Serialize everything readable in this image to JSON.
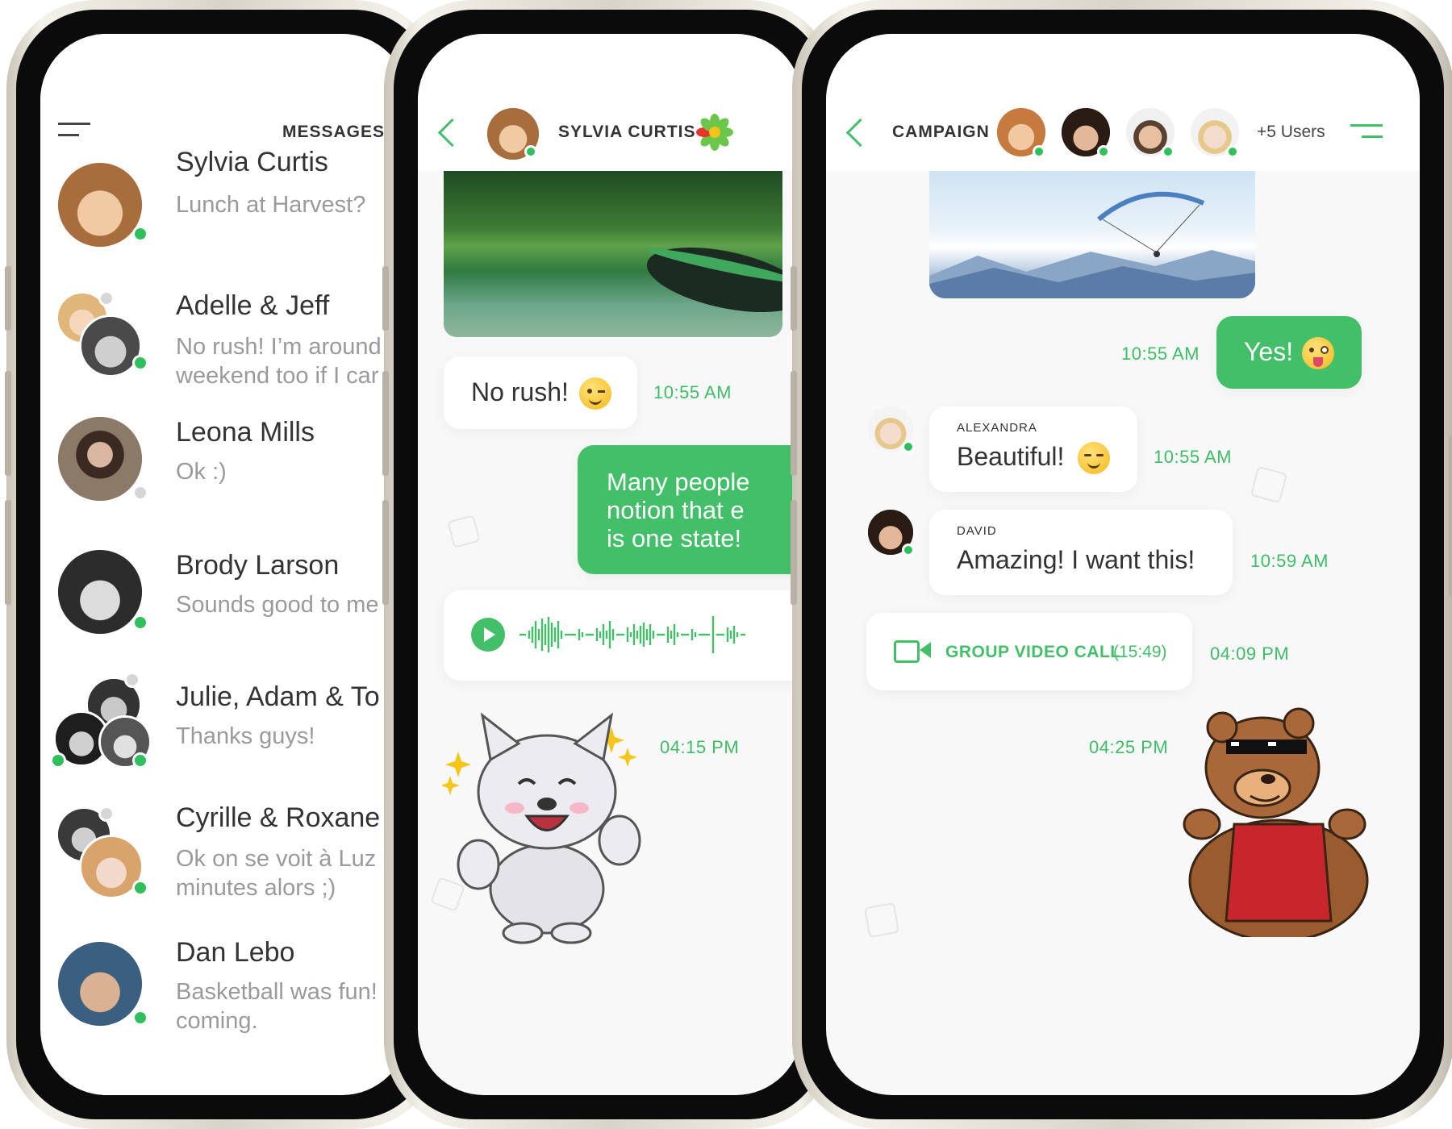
{
  "colors": {
    "accent": "#42bf68",
    "online": "#2fbf5c",
    "offline": "#d6d6d6"
  },
  "inbox": {
    "menu_icon": "hamburger-menu-icon",
    "title": "MESSAGES",
    "conversations": [
      {
        "name": "Sylvia Curtis",
        "preview": "Lunch at Harvest?",
        "status": "online"
      },
      {
        "name": "Adelle & Jeff",
        "preview": "No rush! I’m around\nweekend too if I car",
        "status": "online"
      },
      {
        "name": "Leona Mills",
        "preview": "Ok :)",
        "status": "offline"
      },
      {
        "name": "Brody Larson",
        "preview": "Sounds good to me",
        "status": "online"
      },
      {
        "name": "Julie, Adam & To",
        "preview": "Thanks guys!",
        "status": "online"
      },
      {
        "name": "Cyrille & Roxane",
        "preview": "Ok on se voit à Luz\nminutes alors ;)",
        "status": "online"
      },
      {
        "name": "Dan Lebo",
        "preview": "Basketball was fun!\ncoming.",
        "status": "online"
      }
    ]
  },
  "chat": {
    "back_icon": "chevron-left-icon",
    "contact_name": "SYLVIA CURTIS",
    "logo_icon": "flower-logo-icon",
    "messages": {
      "m1_text": "No rush!",
      "m1_time": "10:55 AM",
      "m2_text": "Many people\nnotion that e\nis one state!",
      "voice_icon": "play-icon",
      "sticker_time": "04:15 PM"
    }
  },
  "group": {
    "back_icon": "chevron-left-icon",
    "title": "CAMPAIGN",
    "extra_users": "+5 Users",
    "menu_icon": "menu-icon",
    "messages": {
      "yes_text": "Yes!",
      "yes_time": "10:55 AM",
      "alexandra_name": "ALEXANDRA",
      "alexandra_text": "Beautiful!",
      "alexandra_time": "10:55 AM",
      "david_name": "DAVID",
      "david_text": "Amazing! I want this!",
      "david_time": "10:59 AM",
      "call_label": "GROUP VIDEO CALL",
      "call_duration": "(15:49)",
      "call_time": "04:09 PM",
      "sticker_time": "04:25 PM"
    }
  }
}
